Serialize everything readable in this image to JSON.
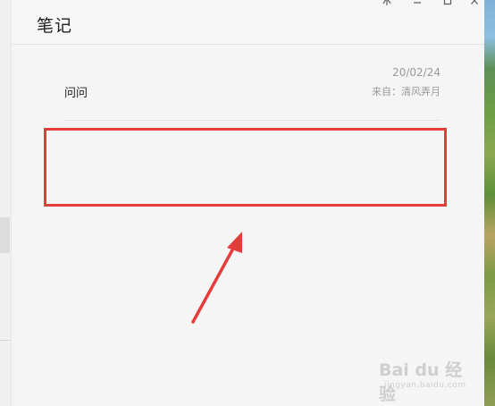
{
  "window": {
    "title": "笔记",
    "controls": {
      "pin_icon": "pin-icon",
      "minimize_icon": "minimize-icon",
      "maximize_icon": "maximize-icon",
      "close_icon": "close-icon"
    }
  },
  "notes": [
    {
      "title": "问问",
      "date": "20/02/24",
      "source": "来自：清风弄月"
    }
  ],
  "annotation": {
    "highlight_color": "#e63b3b",
    "arrow_color": "#e63b3b"
  },
  "watermark": {
    "main": "Bai du 经验",
    "sub": "jingyan.baidu.com"
  }
}
